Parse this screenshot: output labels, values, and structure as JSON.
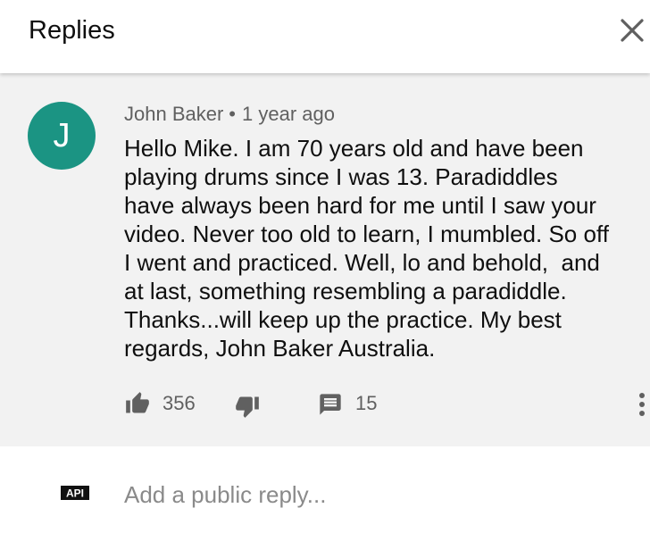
{
  "header": {
    "title": "Replies",
    "close_icon": "close-icon"
  },
  "comment": {
    "avatar_initial": "J",
    "avatar_color": "#1b9483",
    "author": "John Baker",
    "separator": "•",
    "time": "1 year ago",
    "text_lines": [
      "Hello Mike. I am 70 years old and have been",
      "playing drums since I was 13. Paradiddles",
      "have always been hard for me until I saw your",
      "video. Never too old to learn, I mumbled. So off",
      "I went and practiced. Well, lo and behold,  and",
      "at last, something resembling a paradiddle.",
      "Thanks...will keep up the practice. My best",
      "regards, John Baker Australia."
    ],
    "likes": "356",
    "replies": "15"
  },
  "reply_box": {
    "user_thumb_text": "API",
    "placeholder": "Add a public reply..."
  }
}
